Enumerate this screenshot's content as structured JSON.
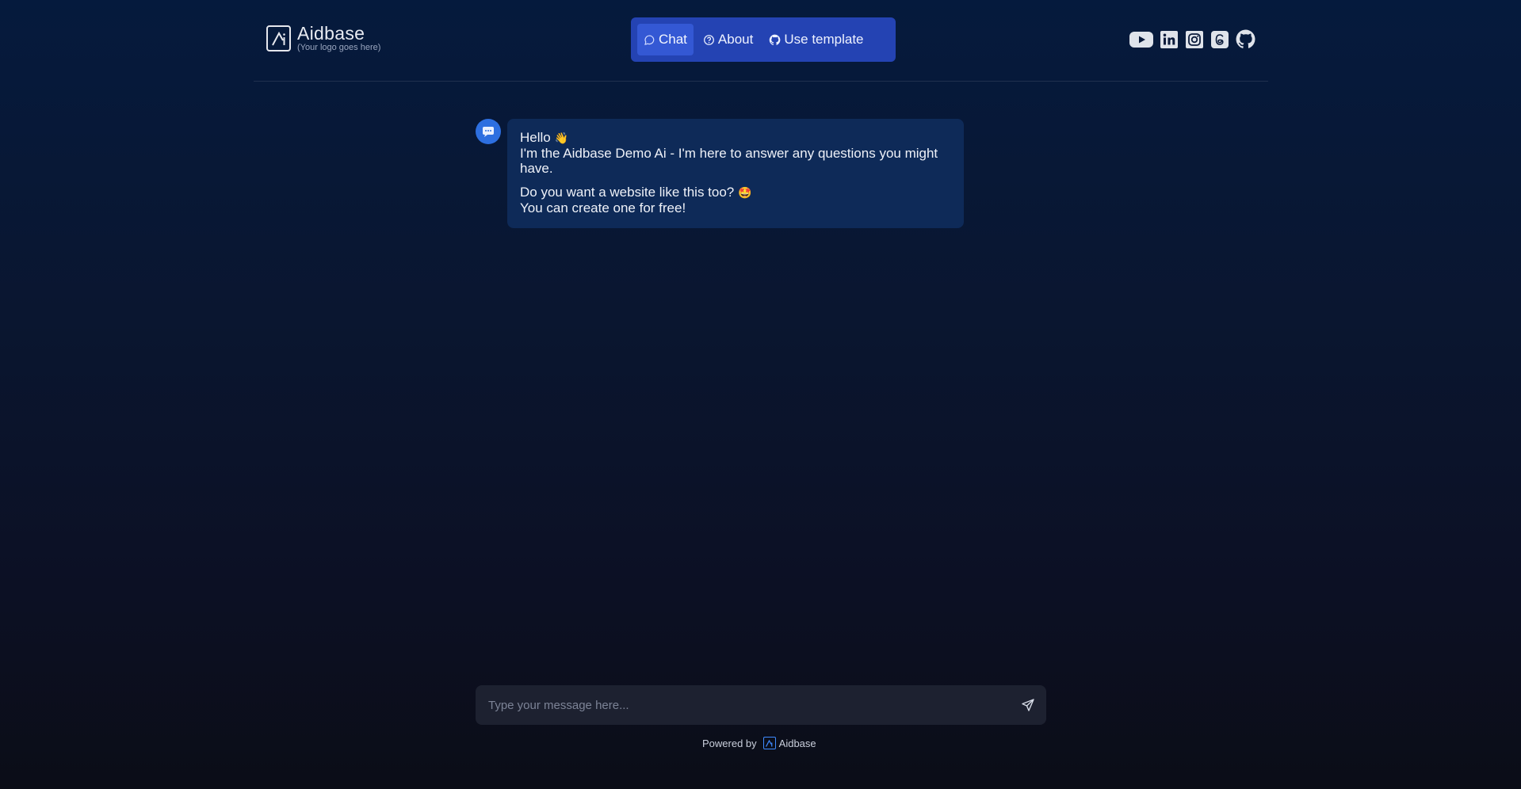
{
  "brand": {
    "name": "Aidbase",
    "subtitle": "(Your logo goes here)"
  },
  "nav": {
    "items": [
      {
        "label": "Chat",
        "icon": "chat-bubble-icon",
        "active": true
      },
      {
        "label": "About",
        "icon": "question-circle-icon",
        "active": false
      },
      {
        "label": "Use template",
        "icon": "github-icon",
        "active": false
      }
    ]
  },
  "socials": [
    "youtube-icon",
    "linkedin-icon",
    "instagram-icon",
    "threads-icon",
    "github-icon"
  ],
  "chat": {
    "message": {
      "line1": "Hello",
      "emoji1": "👋",
      "line2": "I'm the Aidbase Demo Ai - I'm here to answer any questions you might have.",
      "line3": "Do you want a website like this too?",
      "emoji2": "🤩",
      "line4": "You can create one for free!"
    }
  },
  "composer": {
    "placeholder": "Type your message here..."
  },
  "footer": {
    "powered_by": "Powered by",
    "brand": "Aidbase"
  },
  "colors": {
    "accent": "#2443b3",
    "active_tab": "#3458d4",
    "bubble": "#0e2a58",
    "avatar": "#2d6fe0"
  }
}
